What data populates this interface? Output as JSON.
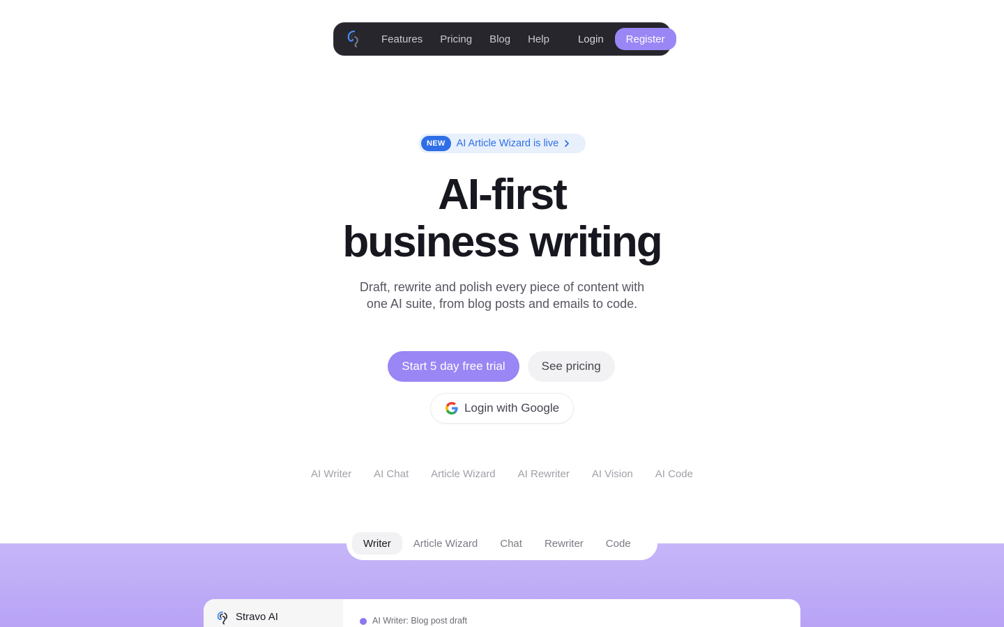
{
  "colors": {
    "accent": "#9a86f5",
    "nav_bg": "#26262c",
    "badge_blue": "#2e6ee6",
    "band_purple": "#c6b6f8"
  },
  "nav": {
    "logo_icon": "stravo-logo-icon",
    "links": [
      "Features",
      "Pricing",
      "Blog",
      "Help"
    ],
    "login": "Login",
    "register": "Register"
  },
  "announcement": {
    "tag": "NEW",
    "text": "AI Article Wizard is live",
    "icon": "chevron-right-icon"
  },
  "hero": {
    "title_line1": "AI-first",
    "title_line2": "business writing",
    "subtitle": "Draft, rewrite and polish every piece of content with one AI suite, from blog posts and emails to code."
  },
  "cta": {
    "primary": "Start 5 day free trial",
    "secondary": "See pricing",
    "google": "Login with Google",
    "google_icon": "google-icon"
  },
  "features": [
    "AI Writer",
    "AI Chat",
    "Article Wizard",
    "AI Rewriter",
    "AI Vision",
    "AI Code"
  ],
  "tabs": {
    "items": [
      "Writer",
      "Article Wizard",
      "Chat",
      "Rewriter",
      "Code"
    ],
    "active": "Writer"
  },
  "preview": {
    "app_name": "Stravo AI",
    "document_label": "AI Writer: Blog post draft"
  }
}
